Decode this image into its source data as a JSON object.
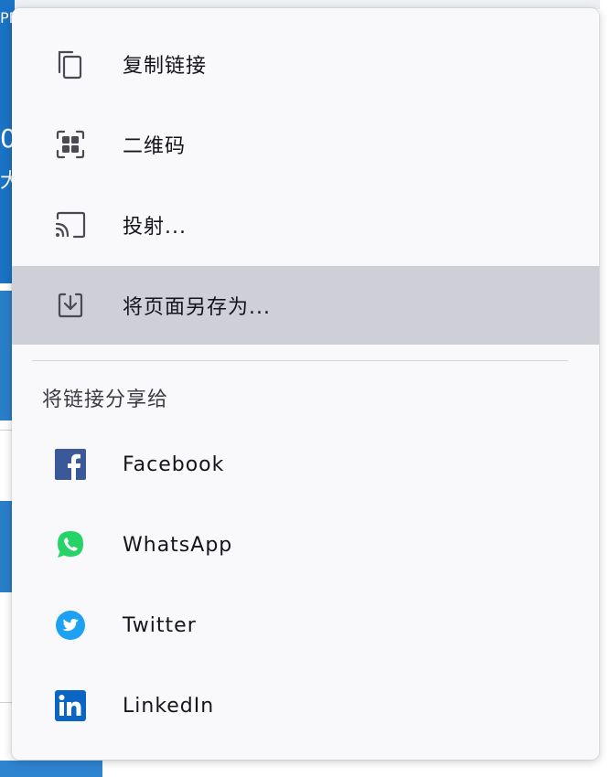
{
  "background_page": {
    "fragments": [
      "PE",
      "0",
      "大"
    ]
  },
  "share_menu": {
    "actions": [
      {
        "label": "复制链接",
        "icon": "copy-icon"
      },
      {
        "label": "二维码",
        "icon": "qr-code-icon"
      },
      {
        "label": "投射...",
        "icon": "cast-icon"
      },
      {
        "label": "将页面另存为...",
        "icon": "save-download-icon",
        "highlighted": true
      }
    ],
    "share_heading": "将链接分享给",
    "services": [
      {
        "label": "Facebook",
        "icon": "facebook-icon",
        "color": "#3b5998"
      },
      {
        "label": "WhatsApp",
        "icon": "whatsapp-icon",
        "color": "#25d366"
      },
      {
        "label": "Twitter",
        "icon": "twitter-icon",
        "color": "#1da1f2"
      },
      {
        "label": "LinkedIn",
        "icon": "linkedin-icon",
        "color": "#0a66c2"
      }
    ]
  },
  "colors": {
    "panel_bg": "#f9f9fb",
    "highlight_bg": "#cfcfd8",
    "text": "#15141a",
    "page_accent": "#1a73c5"
  }
}
